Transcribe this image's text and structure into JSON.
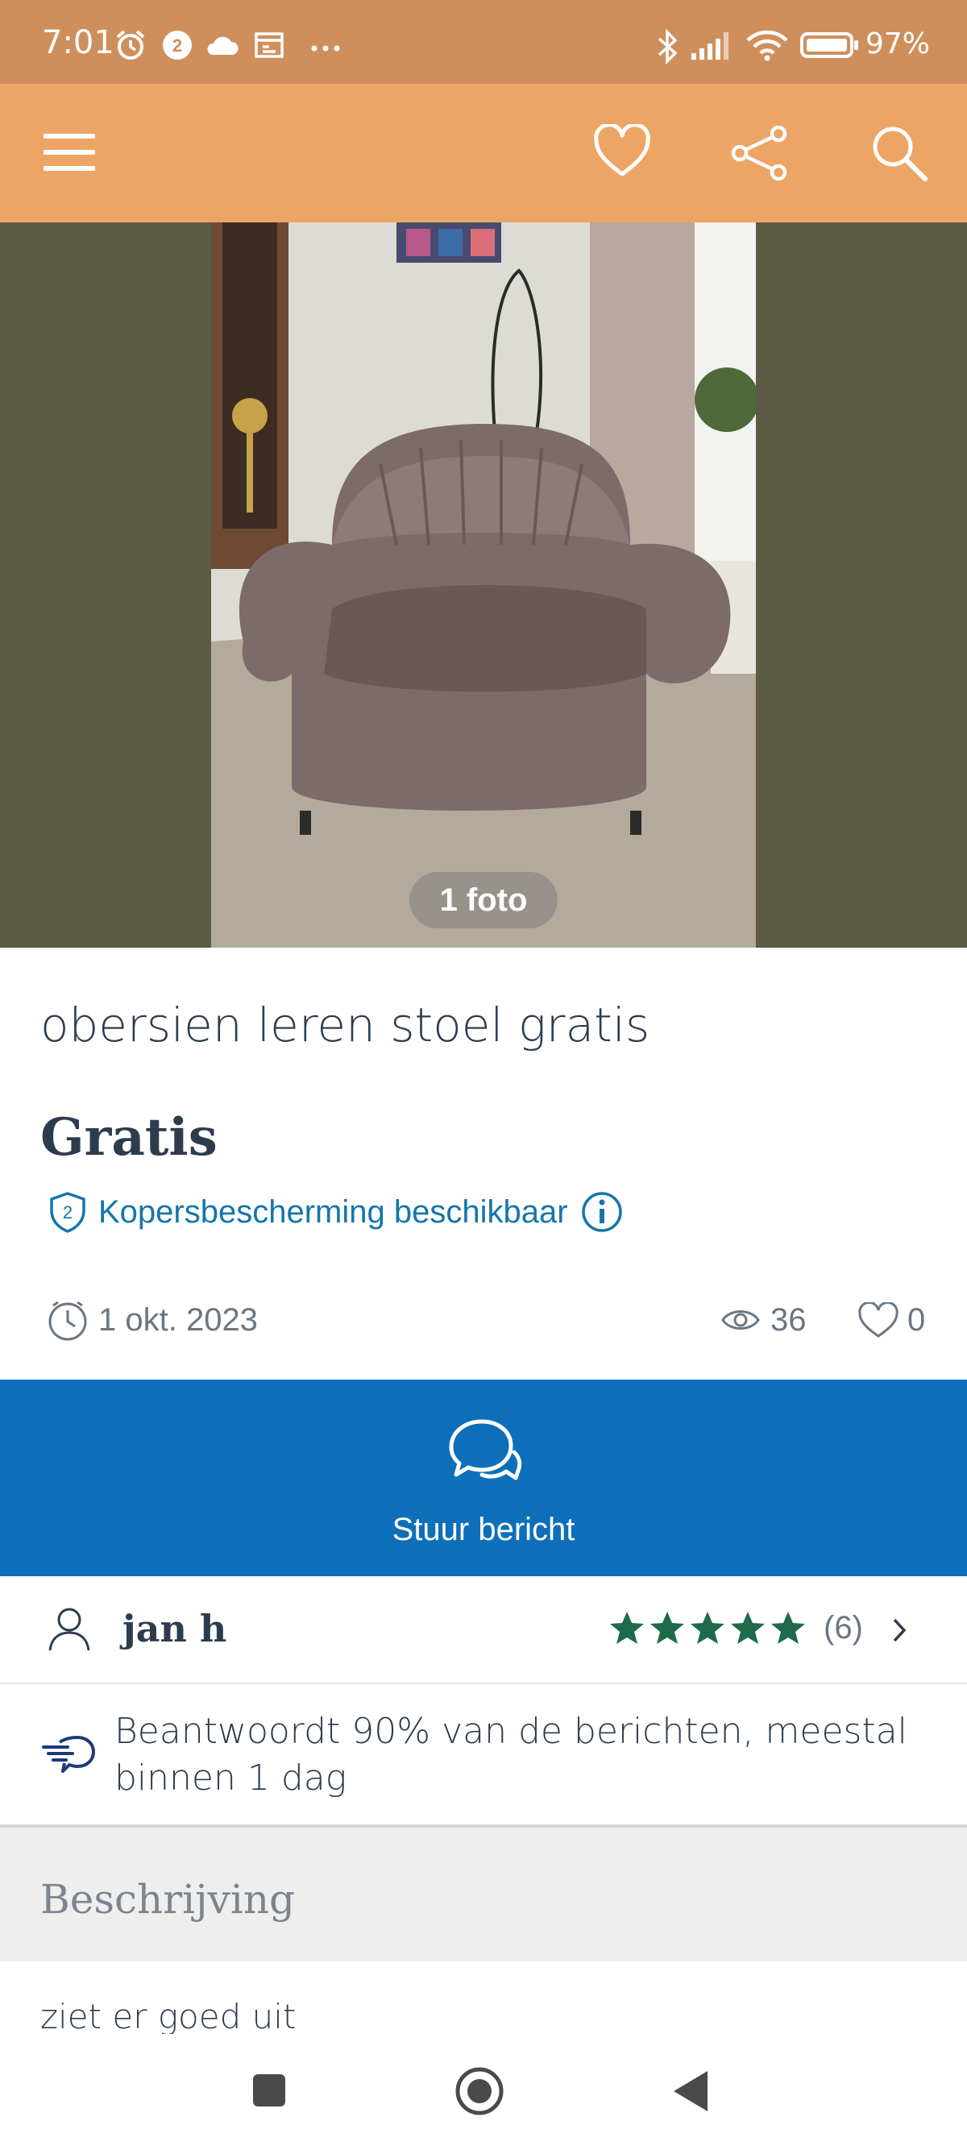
{
  "status_bar": {
    "time": "7:01",
    "battery": "97%",
    "icons": [
      "alarm-icon",
      "notification-2-icon",
      "cloud-icon",
      "calendar-icon",
      "more-dots-icon",
      "bluetooth-icon",
      "signal-icon",
      "wifi-icon",
      "battery-icon"
    ]
  },
  "app_bar": {
    "icons": [
      "menu-icon",
      "heart-icon",
      "share-icon",
      "search-icon"
    ]
  },
  "photo": {
    "count_label": "1 foto"
  },
  "listing": {
    "title": "obersien leren stoel gratis",
    "price": "Gratis",
    "buyer_protection": "Kopersbescherming beschikbaar",
    "date": "1 okt. 2023",
    "views": "36",
    "favorites": "0"
  },
  "message": {
    "label": "Stuur bericht"
  },
  "seller": {
    "name": "jan h",
    "rating_stars": 5,
    "rating_count": "(6)"
  },
  "response": {
    "text": "Beantwoordt 90% van de berichten, meestal binnen 1 dag"
  },
  "description": {
    "title": "Beschrijving",
    "text": "ziet er goed uit"
  },
  "colors": {
    "status_bar": "#cf8f5c",
    "app_bar": "#eda566",
    "accent_blue": "#0d6fba",
    "link_blue": "#1576ab",
    "star_green": "#1e6b4a"
  }
}
